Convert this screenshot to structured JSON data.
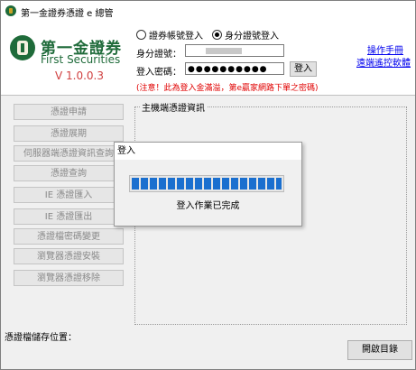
{
  "window": {
    "title": "第一金證券憑證 e 總管"
  },
  "brand": {
    "name_cn": "第一金證券",
    "name_en": "First Securities",
    "version": "V 1.0.0.3"
  },
  "login": {
    "mode_options": [
      "證券帳號登入",
      "身分證號登入"
    ],
    "selected_mode": "身分證號登入",
    "id_label": "身分證號：",
    "id_value": "",
    "pw_label": "登入密碼：",
    "pw_value": "●●●●●●●●●●",
    "login_button": "登入",
    "warning": "(注意！此為登入金滿溢，第e贏家網路下單之密碼)"
  },
  "links": {
    "manual": "操作手冊",
    "remote": "遠端遙控軟體"
  },
  "menu": {
    "items": [
      "憑證申請",
      "憑證展期",
      "伺服器端憑證資訊查詢",
      "憑證查詢",
      "IE 憑證匯入",
      "IE 憑證匯出",
      "憑證檔密碼變更",
      "瀏覽器憑證安裝",
      "瀏覽器憑證移除"
    ]
  },
  "main": {
    "group_label": "主機端憑證資訊"
  },
  "status": {
    "label": "憑證檔儲存位置：",
    "open_dir_button": "開啟目錄"
  },
  "dialog": {
    "title": "登入",
    "message": "登入作業已完成",
    "progress": 1.0
  },
  "colors": {
    "brand_green": "#1f6b3a",
    "accent_red": "#e00000",
    "progress_blue": "#1a6fcf",
    "link_blue": "#0000ee"
  }
}
